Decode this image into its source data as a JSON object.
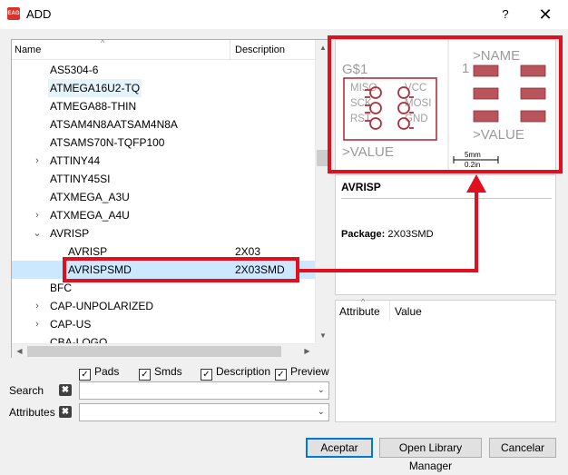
{
  "window": {
    "title": "ADD",
    "icon": "eagle-app-icon",
    "help_label": "?",
    "close_label": "✕"
  },
  "tree": {
    "columns": {
      "name": "Name",
      "description": "Description"
    },
    "rows": [
      {
        "name": "AS5304-6",
        "desc": "",
        "level": 1,
        "expander": ""
      },
      {
        "name": "ATMEGA16U2-TQ",
        "desc": "",
        "level": 1,
        "expander": "",
        "hover": true
      },
      {
        "name": "ATMEGA88-THIN",
        "desc": "",
        "level": 1,
        "expander": ""
      },
      {
        "name": "ATSAM4N8AATSAM4N8A",
        "desc": "",
        "level": 1,
        "expander": ""
      },
      {
        "name": "ATSAMS70N-TQFP100",
        "desc": "",
        "level": 1,
        "expander": ""
      },
      {
        "name": "ATTINY44",
        "desc": "",
        "level": 1,
        "expander": "collapsed"
      },
      {
        "name": "ATTINY45SI",
        "desc": "",
        "level": 1,
        "expander": ""
      },
      {
        "name": "ATXMEGA_A3U",
        "desc": "",
        "level": 1,
        "expander": ""
      },
      {
        "name": "ATXMEGA_A4U",
        "desc": "",
        "level": 1,
        "expander": "collapsed"
      },
      {
        "name": "AVRISP",
        "desc": "",
        "level": 1,
        "expander": "expanded"
      },
      {
        "name": "AVRISP",
        "desc": "2X03",
        "level": 2,
        "expander": ""
      },
      {
        "name": "AVRISPSMD",
        "desc": "2X03SMD",
        "level": 2,
        "expander": "",
        "selected": true
      },
      {
        "name": "BFC",
        "desc": "",
        "level": 1,
        "expander": ""
      },
      {
        "name": "CAP-UNPOLARIZED",
        "desc": "",
        "level": 1,
        "expander": "collapsed"
      },
      {
        "name": "CAP-US",
        "desc": "",
        "level": 1,
        "expander": "collapsed"
      },
      {
        "name": "CBA-LOGO",
        "desc": "",
        "level": 1,
        "expander": ""
      }
    ]
  },
  "filters": {
    "pads": "Pads",
    "smds": "Smds",
    "description": "Description",
    "preview": "Preview"
  },
  "search": {
    "label": "Search",
    "value": ""
  },
  "attributes": {
    "label": "Attributes",
    "value": ""
  },
  "preview": {
    "symbol": {
      "name": "G$1",
      "value": ">VALUE",
      "pins_left": [
        "MISO",
        "SCK",
        "RST"
      ],
      "pins_right": [
        "VCC",
        "MOSI",
        "GND"
      ]
    },
    "package": {
      "pin1": "1",
      "name": ">NAME",
      "value": ">VALUE",
      "scale_top": "5mm",
      "scale_bottom": "0.2in"
    }
  },
  "details": {
    "title": "AVRISP",
    "package_label": "Package:",
    "package_value": "2X03SMD"
  },
  "attr_table": {
    "col_attribute": "Attribute",
    "col_value": "Value"
  },
  "buttons": {
    "accept": "Aceptar",
    "open_library": "Open Library Manager",
    "cancel": "Cancelar"
  },
  "colors": {
    "annotation": "#e0101e",
    "selection": "#cce8ff",
    "symbol": "#b0303a",
    "smd_pad": "#b8545b"
  }
}
